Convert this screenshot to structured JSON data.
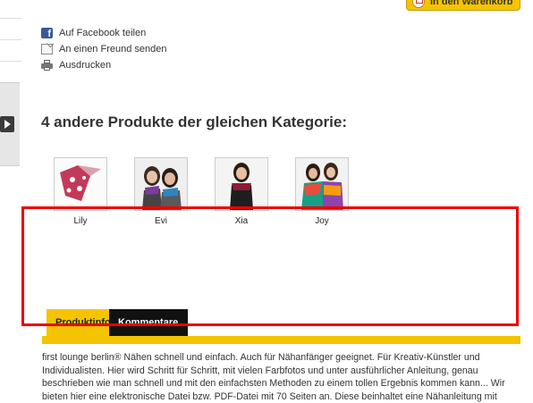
{
  "cart_button": {
    "label": "In den Warenkorb"
  },
  "actions": [
    {
      "label": "Auf Facebook teilen",
      "icon": "facebook-icon"
    },
    {
      "label": "An einen Freund senden",
      "icon": "mail-icon"
    },
    {
      "label": "Ausdrucken",
      "icon": "print-icon"
    }
  ],
  "related": {
    "title": "4 andere Produkte der gleichen Kategorie:",
    "products": [
      {
        "name": "Lily"
      },
      {
        "name": "Evi"
      },
      {
        "name": "Xia"
      },
      {
        "name": "Joy"
      }
    ]
  },
  "tabs": [
    {
      "label": "Produktinfos",
      "active": true
    },
    {
      "label": "Kommentare",
      "active": false
    }
  ],
  "description": "first lounge berlin® Nähen schnell und einfach. Auch für Nähanfänger geeignet. Für Kreativ-Künstler und Individualisten. Hier wird Schritt für Schritt, mit vielen Farbfotos und unter ausführlicher Anleitung, genau beschrieben wie man schnell und mit den einfachsten Methoden zu einem tollen Ergebnis kommen kann... Wir bieten hier eine elektronische Datei bzw. PDF-Datei mit 70 Seiten an. Diese beinhaltet eine Nähanleitung mit",
  "colors": {
    "accent_yellow": "#f5c400",
    "tab_dark": "#111111",
    "highlight_red": "#ee0000"
  }
}
